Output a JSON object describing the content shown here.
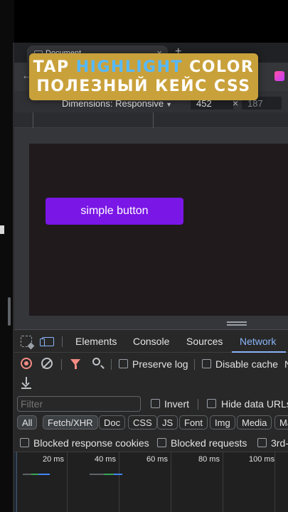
{
  "browser": {
    "tab_title": "Document",
    "tab_close": "×",
    "new_tab": "+",
    "back": "←"
  },
  "banner": {
    "line1_pre": "TAP ",
    "line1_highlight": "HIGHLIGHT",
    "line1_post": " COLOR",
    "line2": "ПОЛЕЗНЫЙ КЕЙС CSS"
  },
  "device_toolbar": {
    "dimensions_label": "Dimensions: Responsive",
    "caret": "▼",
    "width": "452",
    "times": "×",
    "height": "187"
  },
  "page": {
    "button_label": "simple button",
    "button_color": "#7a16e6"
  },
  "devtools": {
    "tabs": [
      "Elements",
      "Console",
      "Sources",
      "Network"
    ],
    "active_tab": "Network",
    "preserve_log": "Preserve log",
    "disable_cache": "Disable cache",
    "overflow_letter": "N",
    "filter_placeholder": "Filter",
    "invert": "Invert",
    "hide_data_urls": "Hide data URLs",
    "type_filters": [
      "All",
      "Fetch/XHR",
      "Doc",
      "CSS",
      "JS",
      "Font",
      "Img",
      "Media",
      "Ma"
    ],
    "active_type_filters": [
      "All",
      "Fetch/XHR"
    ],
    "blocked_response_cookies": "Blocked response cookies",
    "blocked_requests": "Blocked requests",
    "third_party": "3rd-",
    "timeline_labels": [
      "20 ms",
      "40 ms",
      "60 ms",
      "80 ms",
      "100 ms"
    ]
  },
  "colors": {
    "banner_bg": "#c9a13b",
    "highlight_text": "#56b9ff",
    "accent": "#8ab4f8",
    "record": "#f28b82"
  }
}
